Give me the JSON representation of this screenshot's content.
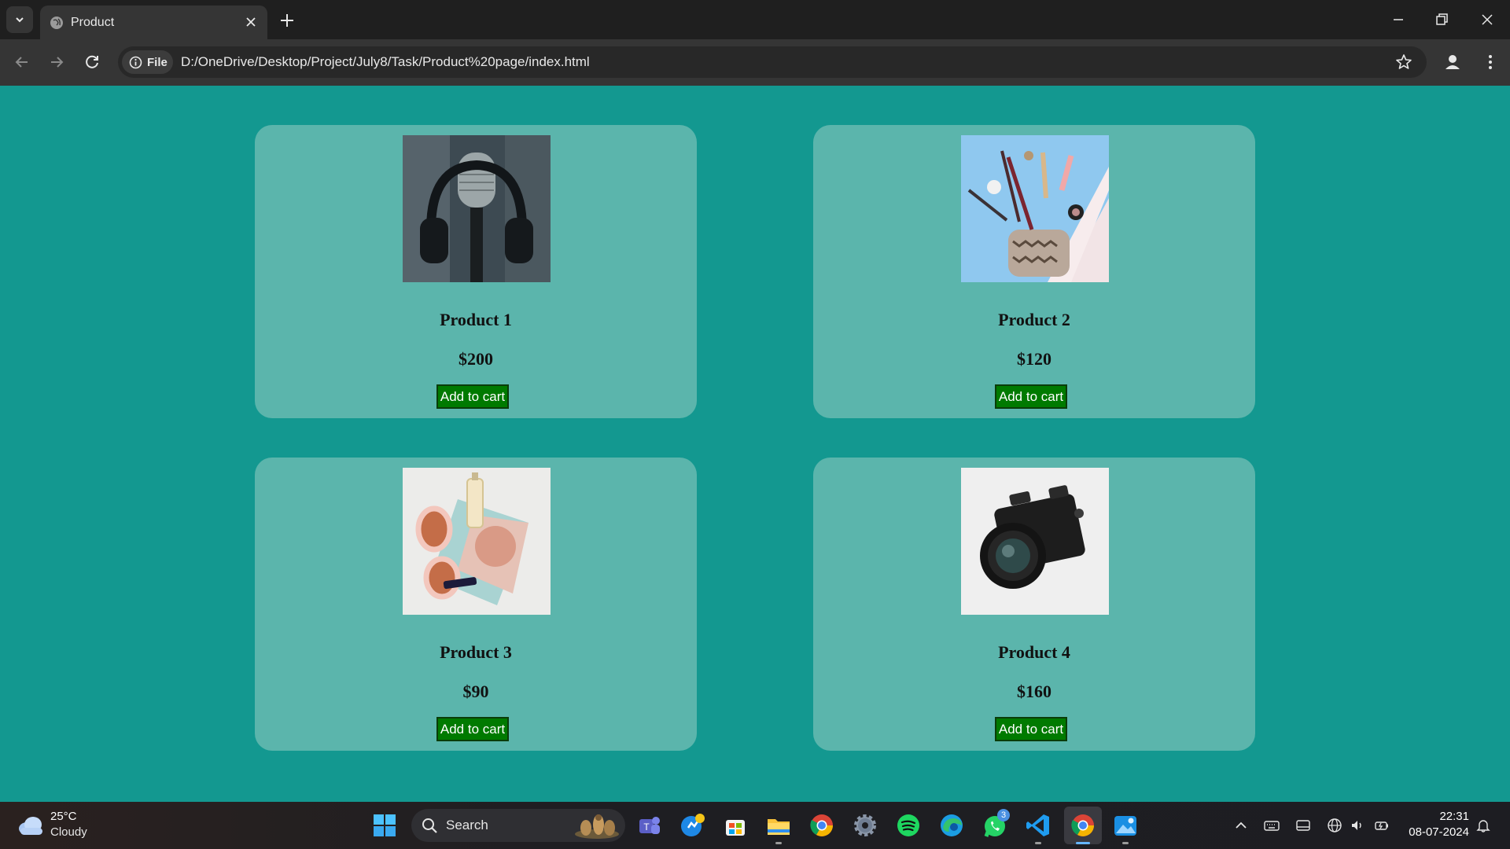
{
  "browser": {
    "tab_title": "Product",
    "address_chip": "File",
    "url": "D:/OneDrive/Desktop/Project/July8/Task/Product%20page/index.html"
  },
  "products": [
    {
      "name": "Product 1",
      "price": "$200",
      "button": "Add to cart",
      "image": "headphones-on-microphone"
    },
    {
      "name": "Product 2",
      "price": "$120",
      "button": "Add to cart",
      "image": "makeup-pouch"
    },
    {
      "name": "Product 3",
      "price": "$90",
      "button": "Add to cart",
      "image": "sunglasses-and-perfume"
    },
    {
      "name": "Product 4",
      "price": "$160",
      "button": "Add to cart",
      "image": "camera"
    }
  ],
  "taskbar": {
    "temperature": "25°C",
    "condition": "Cloudy",
    "search_placeholder": "Search",
    "whatsapp_badge": "3",
    "time": "22:31",
    "date": "08-07-2024"
  },
  "colors": {
    "page_background": "#139890",
    "card_background": "#5bb5ac",
    "button_background": "#007a00"
  }
}
